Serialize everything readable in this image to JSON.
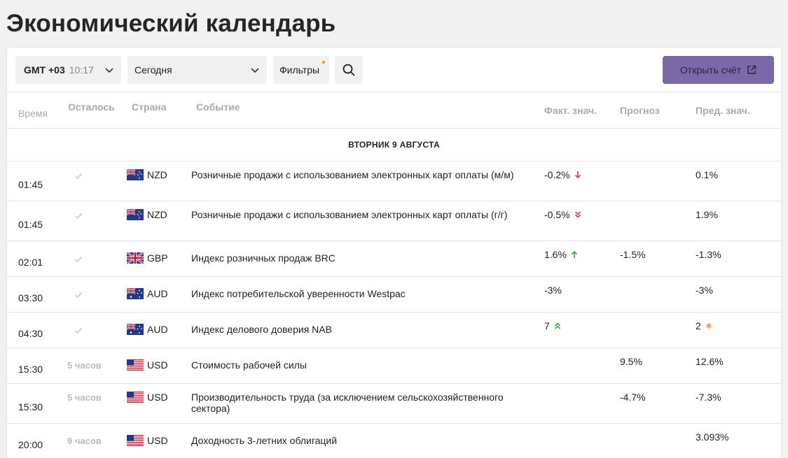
{
  "title": "Экономический календарь",
  "toolbar": {
    "timezone": "GMT +03",
    "time": "10:17",
    "day": "Сегодня",
    "filters": "Фильтры",
    "open_account": "Открыть счёт"
  },
  "columns": {
    "time": "Время",
    "left": "Осталось",
    "country": "Страна",
    "event": "Событие",
    "actual": "Факт. знач.",
    "forecast": "Прогноз",
    "previous": "Пред. знач."
  },
  "date_header": "ВТОРНИК 9 АВГУСТА",
  "events": [
    {
      "time": "01:45",
      "left": "",
      "done": true,
      "currency": "NZD",
      "flag": "nz-flag-icon",
      "event": "Розничные продажи с использованием электронных карт оплаты (м/м)",
      "actual": "-0.2%",
      "actual_icon": "arrow-down-icon",
      "forecast": "",
      "previous": "0.1%",
      "previous_icon": ""
    },
    {
      "time": "01:45",
      "left": "",
      "done": true,
      "currency": "NZD",
      "flag": "nz-flag-icon",
      "event": "Розничные продажи с использованием электронных карт оплаты (г/г)",
      "actual": "-0.5%",
      "actual_icon": "double-chevron-down-icon",
      "forecast": "",
      "previous": "1.9%",
      "previous_icon": ""
    },
    {
      "time": "02:01",
      "left": "",
      "done": true,
      "currency": "GBP",
      "flag": "uk-flag-icon",
      "event": "Индекс розничных продаж BRC",
      "actual": "1.6%",
      "actual_icon": "arrow-up-icon",
      "forecast": "-1.5%",
      "previous": "-1.3%",
      "previous_icon": ""
    },
    {
      "time": "03:30",
      "left": "",
      "done": true,
      "currency": "AUD",
      "flag": "au-flag-icon",
      "event": "Индекс потребительской уверенности Westpac",
      "actual": "-3%",
      "actual_icon": "",
      "forecast": "",
      "previous": "-3%",
      "previous_icon": ""
    },
    {
      "time": "04:30",
      "left": "",
      "done": true,
      "currency": "AUD",
      "flag": "au-flag-icon",
      "event": "Индекс делового доверия NAB",
      "actual": "7",
      "actual_icon": "double-chevron-up-icon",
      "forecast": "",
      "previous": "2",
      "previous_icon": "asterisk-icon"
    },
    {
      "time": "15:30",
      "left": "5 часов",
      "done": false,
      "currency": "USD",
      "flag": "us-flag-icon",
      "event": "Стоимость рабочей силы",
      "actual": "",
      "actual_icon": "",
      "forecast": "9.5%",
      "previous": "12.6%",
      "previous_icon": ""
    },
    {
      "time": "15:30",
      "left": "5 часов",
      "done": false,
      "currency": "USD",
      "flag": "us-flag-icon",
      "event": "Производительность труда (за исключением сельскохозяйственного сектора)",
      "actual": "",
      "actual_icon": "",
      "forecast": "-4.7%",
      "previous": "-7.3%",
      "previous_icon": ""
    },
    {
      "time": "20:00",
      "left": "9 часов",
      "done": false,
      "currency": "USD",
      "flag": "us-flag-icon",
      "event": "Доходность 3-летних облигаций",
      "actual": "",
      "actual_icon": "",
      "forecast": "",
      "previous": "3.093%",
      "previous_icon": ""
    }
  ],
  "colors": {
    "accent": "#7b68a8",
    "down": "#e53935",
    "up": "#43a047",
    "highlight": "#f28a3c"
  }
}
